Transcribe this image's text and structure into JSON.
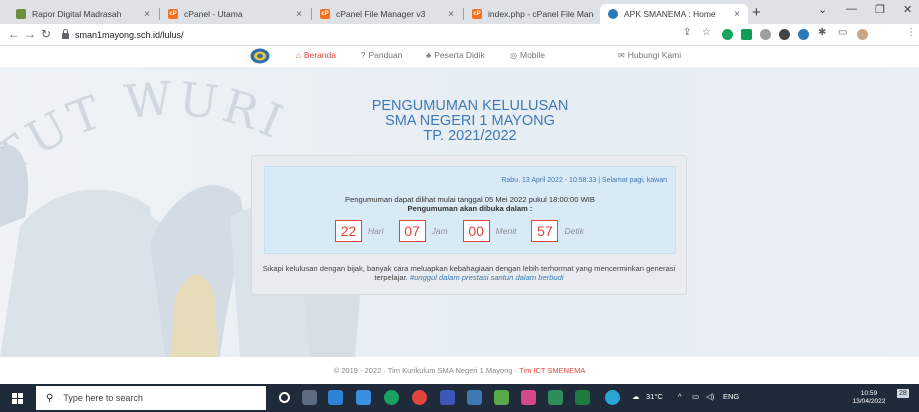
{
  "browser": {
    "tabs": [
      {
        "title": "Rapor Digital Madrasah",
        "icon": "madrasah-favicon",
        "active": false
      },
      {
        "title": "cPanel - Utama",
        "icon": "cpanel-favicon",
        "active": false
      },
      {
        "title": "cPanel File Manager v3",
        "icon": "cpanel-favicon",
        "active": false
      },
      {
        "title": "index.php - cPanel File Mana",
        "icon": "cpanel-favicon",
        "active": false
      },
      {
        "title": "APK SMANEMA : Home",
        "icon": "apk-favicon",
        "active": true
      }
    ],
    "url": "sman1mayong.sch.id/lulus/"
  },
  "nav": {
    "items": [
      {
        "label": "Beranda",
        "icon": "home-icon"
      },
      {
        "label": "Panduan",
        "icon": "question-icon"
      },
      {
        "label": "Peserta Didik",
        "icon": "users-icon"
      },
      {
        "label": "Mobile",
        "icon": "whatsapp-icon"
      },
      {
        "label": "Hubungi Kami",
        "icon": "envelope-icon"
      }
    ]
  },
  "background": {
    "watermark": "TUT WURI HANDAYANI"
  },
  "announcement": {
    "title_line1": "PENGUMUMAN KELULUSAN",
    "title_line2": "SMA NEGERI 1 MAYONG",
    "title_line3": "TP. 2021/2022",
    "datetime": "Rabu, 13 April 2022 - 10:58:33 | Selamat pagi, kawan",
    "notice": "Pengumuman dapat dilihat mulai tanggal 05 Mei 2022 pukul 18:00:00 WIB",
    "opens_in": "Pengumuman akan dibuka dalam :",
    "countdown": [
      {
        "value": "22",
        "unit": "Hari"
      },
      {
        "value": "07",
        "unit": "Jam"
      },
      {
        "value": "00",
        "unit": "Menit"
      },
      {
        "value": "57",
        "unit": "Detik"
      }
    ],
    "closing": "Sikapi kelulusan dengan bijak, banyak cara meluapkan kebahagiaan dengan lebih terhormat yang mencerminkan generasi terpelajar.",
    "hashtag": "#unggul dalam prestasi santun dalam berbudi"
  },
  "footer": {
    "text": "© 2019 - 2022 · Tim Kurikulum SMA Negeri 1 Mayong · ",
    "link": "Tim ICT SMENEMA"
  },
  "taskbar": {
    "search_placeholder": "Type here to search",
    "weather": "31°C",
    "language": "ENG",
    "time": "10:59",
    "date": "13/04/2022",
    "notifications": "28"
  },
  "colors": {
    "accent_red": "#e0463c",
    "heading_blue": "#3f79b4",
    "inner_panel": "#d9eaf7",
    "taskbar": "#1f2a3a"
  }
}
